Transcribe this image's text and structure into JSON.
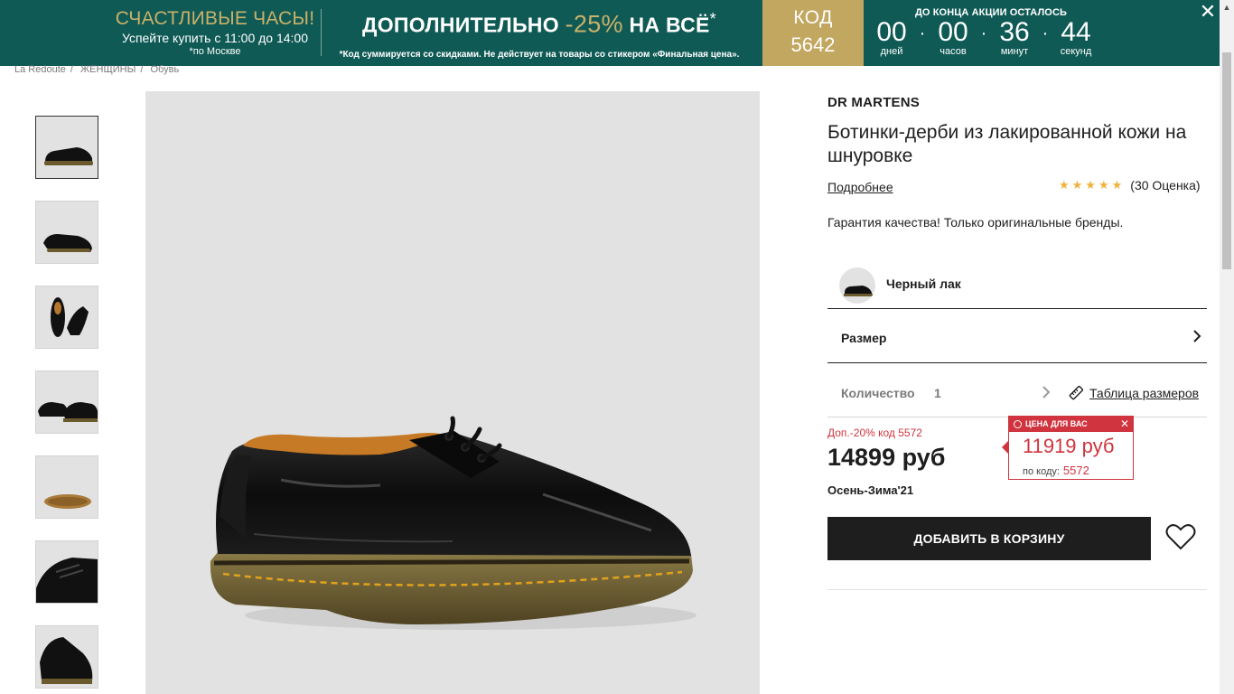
{
  "promo": {
    "happy_title": "СЧАСТЛИВЫЕ ЧАСЫ!",
    "happy_sub": "Успейте купить с 11:00 до 14:00",
    "happy_sub2": "*по Москве",
    "offer_prefix": "ДОПОЛНИТЕЛЬНО",
    "offer_pct": "-25%",
    "offer_suffix": "НА ВСЁ",
    "offer_star": "*",
    "offer_note": "*Код суммируется со скидками. Не действует на товары со стикером «Финальная цена».",
    "code_label": "КОД",
    "code_value": "5642",
    "timer_caption": "ДО КОНЦА АКЦИИ ОСТАЛОСЬ",
    "timer": [
      {
        "n": "00",
        "u": "дней"
      },
      {
        "n": "00",
        "u": "часов"
      },
      {
        "n": "36",
        "u": "минут"
      },
      {
        "n": "44",
        "u": "секунд"
      }
    ],
    "close_icon": "✕"
  },
  "breadcrumb": [
    "La Redoute",
    "ЖЕНЩИНЫ",
    "Обувь"
  ],
  "product": {
    "brand": "DR MARTENS",
    "title": "Ботинки-дерби из лакированной кожи на шнуровке",
    "more_link": "Подробнее",
    "stars": "★★★★★",
    "rating_text": "(30 Оценка)",
    "guarantee": "Гарантия качества! Только оригинальные бренды.",
    "color_name": "Черный лак",
    "size_label": "Размер",
    "qty_label": "Количество",
    "qty_value": "1",
    "size_table_link": "Таблица размеров",
    "promo_line": "Доп.-20% код 5572",
    "price": "14899 руб",
    "season": "Осень-Зима'21",
    "add_to_cart": "ДОБАВИТЬ В КОРЗИНУ"
  },
  "price_box": {
    "head": "ЦЕНА ДЛЯ ВАС",
    "close": "✕",
    "amount": "11919 руб",
    "code_label": "по коду:",
    "code_value": "5572"
  },
  "colors": {
    "banner_bg": "#0f5a55",
    "gold": "#c2a760",
    "accent_red": "#d0343e",
    "star": "#f0b33a"
  }
}
